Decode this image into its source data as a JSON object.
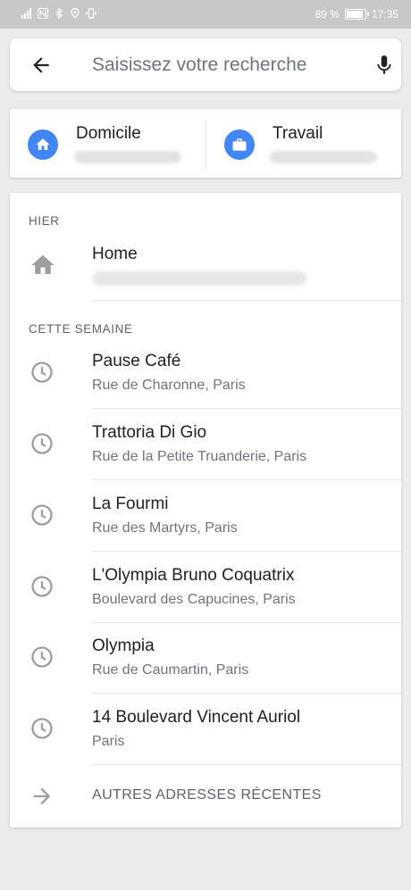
{
  "status_bar": {
    "battery_text": "89 %",
    "time": "17:35"
  },
  "search": {
    "placeholder": "Saisissez votre recherche"
  },
  "places": {
    "home_label": "Domicile",
    "work_label": "Travail"
  },
  "recent": {
    "section_yesterday": "HIER",
    "section_week": "CETTE SEMAINE",
    "yesterday_items": [
      {
        "title": "Home",
        "icon": "home-icon"
      }
    ],
    "week_items": [
      {
        "title": "Pause Café",
        "subtitle": "Rue de Charonne, Paris",
        "icon": "clock-icon"
      },
      {
        "title": "Trattoria Di Gio",
        "subtitle": "Rue de la Petite Truanderie, Paris",
        "icon": "clock-icon"
      },
      {
        "title": "La Fourmi",
        "subtitle": "Rue des Martyrs, Paris",
        "icon": "clock-icon"
      },
      {
        "title": "L'Olympia Bruno Coquatrix",
        "subtitle": "Boulevard des Capucines, Paris",
        "icon": "clock-icon"
      },
      {
        "title": "Olympia",
        "subtitle": "Rue de Caumartin, Paris",
        "icon": "clock-icon"
      },
      {
        "title": "14 Boulevard Vincent Auriol",
        "subtitle": "Paris",
        "icon": "clock-icon"
      }
    ],
    "more_label": "AUTRES ADRESSES RÉCENTES"
  },
  "colors": {
    "accent": "#4285f4",
    "status_bar": "#c8c8c8",
    "background": "#ececec"
  }
}
